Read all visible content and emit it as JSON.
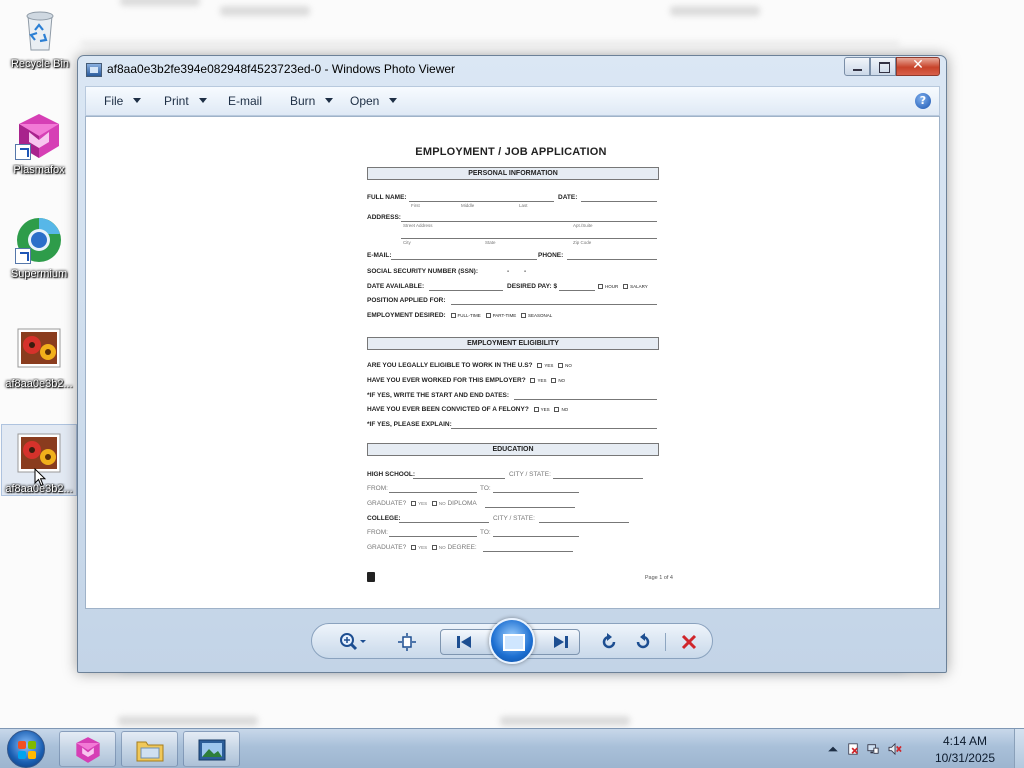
{
  "desktop": {
    "icons": [
      {
        "label": "Recycle Bin"
      },
      {
        "label": "Plasmafox"
      },
      {
        "label": "Supermium"
      },
      {
        "label": "af8aa0e3b2..."
      },
      {
        "label": "af8aa0e3b2..."
      }
    ]
  },
  "window": {
    "title": "af8aa0e3b2fe394e082948f4523723ed-0 - Windows Photo Viewer",
    "menu": {
      "file": "File",
      "print": "Print",
      "email": "E-mail",
      "burn": "Burn",
      "open": "Open"
    },
    "help": "?"
  },
  "document": {
    "title": "EMPLOYMENT / JOB APPLICATION",
    "sections": {
      "personal": "PERSONAL INFORMATION",
      "eligibility": "EMPLOYMENT ELIGIBILITY",
      "education": "EDUCATION"
    },
    "fields": {
      "full_name": "FULL NAME:",
      "date": "DATE:",
      "name_first": "First",
      "name_middle": "Middle",
      "name_last": "Last",
      "address": "ADDRESS:",
      "street_address": "Street Address",
      "apt_suite": "Apt./Suite",
      "city": "City",
      "state": "State",
      "zip": "Zip Code",
      "email": "E-MAIL:",
      "phone": "PHONE:",
      "ssn": "SOCIAL SECURITY NUMBER (SSN):",
      "ssn_sep": "-",
      "date_available": "DATE AVAILABLE:",
      "desired_pay": "DESIRED PAY: $",
      "hour": "HOUR",
      "salary": "SALARY",
      "position": "POSITION APPLIED FOR:",
      "employment_desired": "EMPLOYMENT DESIRED:",
      "full_time": "FULL-TIME",
      "part_time": "PART-TIME",
      "seasonal": "SEASONAL",
      "legally_eligible": "ARE YOU LEGALLY ELIGIBLE TO WORK IN THE U.S?",
      "worked_before": "HAVE YOU EVER WORKED FOR THIS EMPLOYER?",
      "start_end": "*IF YES, WRITE THE START AND END DATES:",
      "felony": "HAVE YOU EVER BEEN CONVICTED OF A FELONY?",
      "explain": "*IF YES, PLEASE EXPLAIN:",
      "yes": "YES",
      "no": "NO",
      "high_school": "HIGH SCHOOL:",
      "city_state": "CITY / STATE:",
      "from": "FROM:",
      "to": "TO:",
      "graduate": "GRADUATE?",
      "diploma": "DIPLOMA",
      "college": "COLLEGE:",
      "degree": "DEGREE:"
    },
    "page_number": "Page 1 of 4"
  },
  "taskbar": {
    "clock_time": "4:14 AM",
    "clock_date": "10/31/2025"
  },
  "icons": {
    "zoom": "magnifier-icon",
    "actual_size": "fit-window-icon",
    "prev": "previous-icon",
    "slideshow": "slideshow-icon",
    "next": "next-icon",
    "rotate_ccw": "rotate-counterclockwise-icon",
    "rotate_cw": "rotate-clockwise-icon",
    "delete": "delete-icon"
  },
  "colors": {
    "accent": "#1d6fd1",
    "delete_red": "#d0262b",
    "close_button": "#c7432a"
  }
}
